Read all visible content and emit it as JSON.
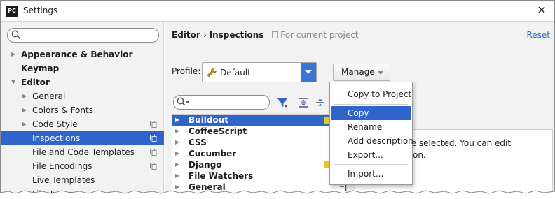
{
  "window": {
    "title": "Settings",
    "app_icon_text": "PC",
    "close_glyph": "✕"
  },
  "sidebar": {
    "search_value": "",
    "items": [
      {
        "label": "Appearance & Behavior",
        "bold": true,
        "arrow": "▶"
      },
      {
        "label": "Keymap",
        "bold": true,
        "arrow": ""
      },
      {
        "label": "Editor",
        "bold": true,
        "arrow": "▼"
      },
      {
        "label": "General",
        "bold": false,
        "arrow": "▶"
      },
      {
        "label": "Colors & Fonts",
        "bold": false,
        "arrow": "▶"
      },
      {
        "label": "Code Style",
        "bold": false,
        "arrow": "▶"
      },
      {
        "label": "Inspections",
        "bold": false,
        "arrow": "",
        "selected": true
      },
      {
        "label": "File and Code Templates",
        "bold": false,
        "arrow": ""
      },
      {
        "label": "File Encodings",
        "bold": false,
        "arrow": ""
      },
      {
        "label": "Live Templates",
        "bold": false,
        "arrow": ""
      },
      {
        "label": "File Types",
        "bold": false,
        "arrow": ""
      }
    ]
  },
  "header": {
    "crumb_1": "Editor",
    "separator": "›",
    "crumb_2": "Inspections",
    "scope": "For current project",
    "reset_label": "Reset"
  },
  "profile": {
    "label": "Profile:",
    "value": "Default",
    "manage_label": "Manage"
  },
  "filter": {
    "value": ""
  },
  "inspections": [
    {
      "label": "Buildout",
      "selected": true,
      "severity": true,
      "check": ""
    },
    {
      "label": "CoffeeScript",
      "selected": false,
      "severity": false,
      "check": ""
    },
    {
      "label": "CSS",
      "selected": false,
      "severity": false,
      "check": ""
    },
    {
      "label": "Cucumber",
      "selected": false,
      "severity": false,
      "check": ""
    },
    {
      "label": "Django",
      "selected": false,
      "severity": true,
      "check": ""
    },
    {
      "label": "File Watchers",
      "selected": false,
      "severity": false,
      "check": ""
    },
    {
      "label": "General",
      "selected": false,
      "severity": false,
      "check": "−"
    }
  ],
  "description": {
    "line_1": "pections are selected. You can edit",
    "line_2": "gle inspection."
  },
  "manage_menu": {
    "items": [
      {
        "label": "Copy to Project"
      },
      {
        "label": "Copy",
        "active": true
      },
      {
        "label": "Rename"
      },
      {
        "label": "Add description"
      },
      {
        "label": "Export..."
      },
      {
        "label": "Import..."
      }
    ]
  },
  "colors": {
    "selection": "#2f65ca",
    "link": "#2f65ca",
    "severity_warning": "#f0c419"
  }
}
